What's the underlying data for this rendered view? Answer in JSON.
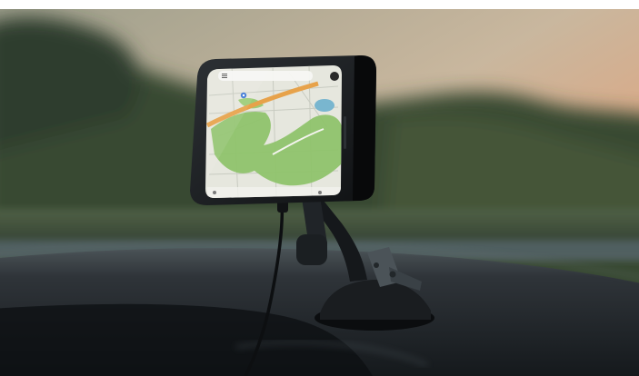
{
  "scene": {
    "subject": "smartphone-in-dashboard-mount",
    "phone_screen": {
      "app": "map",
      "search_bar_text": "",
      "icons": [
        "menu-icon",
        "profile-icon",
        "location-pin-icon"
      ]
    },
    "colors": {
      "sky_top": "#c8b59a",
      "sky_warm": "#e4a27a",
      "tree_line": "#38452f",
      "dashboard": "#1f2327",
      "map_land": "#e8eadf",
      "map_park": "#8fc26b",
      "map_road": "#e7a24a",
      "map_water": "#79b6cf"
    }
  }
}
